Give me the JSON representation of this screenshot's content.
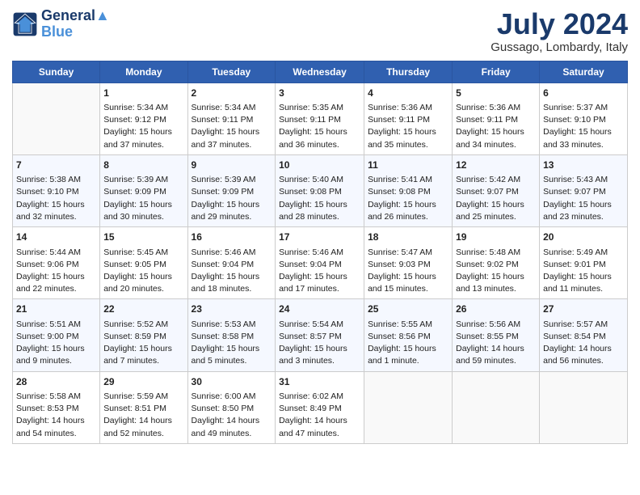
{
  "logo": {
    "line1": "General",
    "line2": "Blue"
  },
  "title": "July 2024",
  "location": "Gussago, Lombardy, Italy",
  "weekdays": [
    "Sunday",
    "Monday",
    "Tuesday",
    "Wednesday",
    "Thursday",
    "Friday",
    "Saturday"
  ],
  "weeks": [
    [
      {
        "day": "",
        "info": ""
      },
      {
        "day": "1",
        "info": "Sunrise: 5:34 AM\nSunset: 9:12 PM\nDaylight: 15 hours\nand 37 minutes."
      },
      {
        "day": "2",
        "info": "Sunrise: 5:34 AM\nSunset: 9:11 PM\nDaylight: 15 hours\nand 37 minutes."
      },
      {
        "day": "3",
        "info": "Sunrise: 5:35 AM\nSunset: 9:11 PM\nDaylight: 15 hours\nand 36 minutes."
      },
      {
        "day": "4",
        "info": "Sunrise: 5:36 AM\nSunset: 9:11 PM\nDaylight: 15 hours\nand 35 minutes."
      },
      {
        "day": "5",
        "info": "Sunrise: 5:36 AM\nSunset: 9:11 PM\nDaylight: 15 hours\nand 34 minutes."
      },
      {
        "day": "6",
        "info": "Sunrise: 5:37 AM\nSunset: 9:10 PM\nDaylight: 15 hours\nand 33 minutes."
      }
    ],
    [
      {
        "day": "7",
        "info": "Sunrise: 5:38 AM\nSunset: 9:10 PM\nDaylight: 15 hours\nand 32 minutes."
      },
      {
        "day": "8",
        "info": "Sunrise: 5:39 AM\nSunset: 9:09 PM\nDaylight: 15 hours\nand 30 minutes."
      },
      {
        "day": "9",
        "info": "Sunrise: 5:39 AM\nSunset: 9:09 PM\nDaylight: 15 hours\nand 29 minutes."
      },
      {
        "day": "10",
        "info": "Sunrise: 5:40 AM\nSunset: 9:08 PM\nDaylight: 15 hours\nand 28 minutes."
      },
      {
        "day": "11",
        "info": "Sunrise: 5:41 AM\nSunset: 9:08 PM\nDaylight: 15 hours\nand 26 minutes."
      },
      {
        "day": "12",
        "info": "Sunrise: 5:42 AM\nSunset: 9:07 PM\nDaylight: 15 hours\nand 25 minutes."
      },
      {
        "day": "13",
        "info": "Sunrise: 5:43 AM\nSunset: 9:07 PM\nDaylight: 15 hours\nand 23 minutes."
      }
    ],
    [
      {
        "day": "14",
        "info": "Sunrise: 5:44 AM\nSunset: 9:06 PM\nDaylight: 15 hours\nand 22 minutes."
      },
      {
        "day": "15",
        "info": "Sunrise: 5:45 AM\nSunset: 9:05 PM\nDaylight: 15 hours\nand 20 minutes."
      },
      {
        "day": "16",
        "info": "Sunrise: 5:46 AM\nSunset: 9:04 PM\nDaylight: 15 hours\nand 18 minutes."
      },
      {
        "day": "17",
        "info": "Sunrise: 5:46 AM\nSunset: 9:04 PM\nDaylight: 15 hours\nand 17 minutes."
      },
      {
        "day": "18",
        "info": "Sunrise: 5:47 AM\nSunset: 9:03 PM\nDaylight: 15 hours\nand 15 minutes."
      },
      {
        "day": "19",
        "info": "Sunrise: 5:48 AM\nSunset: 9:02 PM\nDaylight: 15 hours\nand 13 minutes."
      },
      {
        "day": "20",
        "info": "Sunrise: 5:49 AM\nSunset: 9:01 PM\nDaylight: 15 hours\nand 11 minutes."
      }
    ],
    [
      {
        "day": "21",
        "info": "Sunrise: 5:51 AM\nSunset: 9:00 PM\nDaylight: 15 hours\nand 9 minutes."
      },
      {
        "day": "22",
        "info": "Sunrise: 5:52 AM\nSunset: 8:59 PM\nDaylight: 15 hours\nand 7 minutes."
      },
      {
        "day": "23",
        "info": "Sunrise: 5:53 AM\nSunset: 8:58 PM\nDaylight: 15 hours\nand 5 minutes."
      },
      {
        "day": "24",
        "info": "Sunrise: 5:54 AM\nSunset: 8:57 PM\nDaylight: 15 hours\nand 3 minutes."
      },
      {
        "day": "25",
        "info": "Sunrise: 5:55 AM\nSunset: 8:56 PM\nDaylight: 15 hours\nand 1 minute."
      },
      {
        "day": "26",
        "info": "Sunrise: 5:56 AM\nSunset: 8:55 PM\nDaylight: 14 hours\nand 59 minutes."
      },
      {
        "day": "27",
        "info": "Sunrise: 5:57 AM\nSunset: 8:54 PM\nDaylight: 14 hours\nand 56 minutes."
      }
    ],
    [
      {
        "day": "28",
        "info": "Sunrise: 5:58 AM\nSunset: 8:53 PM\nDaylight: 14 hours\nand 54 minutes."
      },
      {
        "day": "29",
        "info": "Sunrise: 5:59 AM\nSunset: 8:51 PM\nDaylight: 14 hours\nand 52 minutes."
      },
      {
        "day": "30",
        "info": "Sunrise: 6:00 AM\nSunset: 8:50 PM\nDaylight: 14 hours\nand 49 minutes."
      },
      {
        "day": "31",
        "info": "Sunrise: 6:02 AM\nSunset: 8:49 PM\nDaylight: 14 hours\nand 47 minutes."
      },
      {
        "day": "",
        "info": ""
      },
      {
        "day": "",
        "info": ""
      },
      {
        "day": "",
        "info": ""
      }
    ]
  ]
}
